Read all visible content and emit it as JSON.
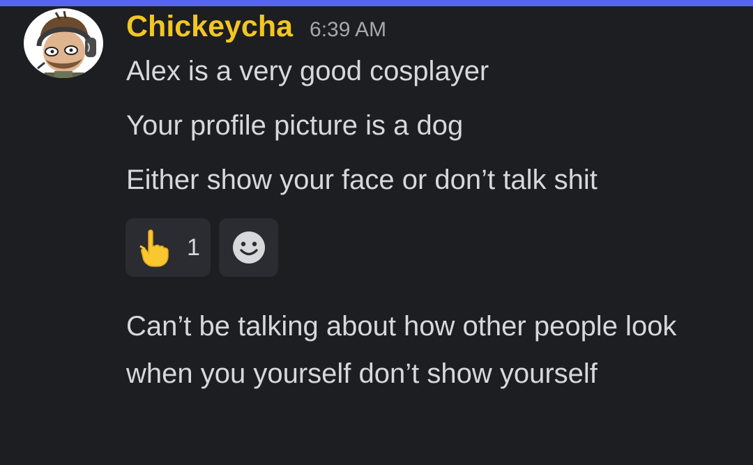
{
  "message": {
    "author": "Chickeycha",
    "timestamp": "6:39 AM",
    "lines": [
      "Alex is a very good cosplayer",
      "Your profile picture is a dog",
      "Either show your face or don’t talk shit"
    ],
    "reactions": [
      {
        "emoji": "pointing-up-hand-icon",
        "count": "1"
      }
    ],
    "add_reaction_icon": "smiley-add-reaction-icon"
  },
  "followup": {
    "text": "Can’t be talking about how other people look when you yourself don’t show yourself"
  },
  "colors": {
    "accent": "#5865f2",
    "background": "#1d1e22",
    "username": "#f2c623",
    "text": "#d6d8dc",
    "timestamp": "#a6a8ad",
    "reaction_bg": "#2b2c31"
  }
}
